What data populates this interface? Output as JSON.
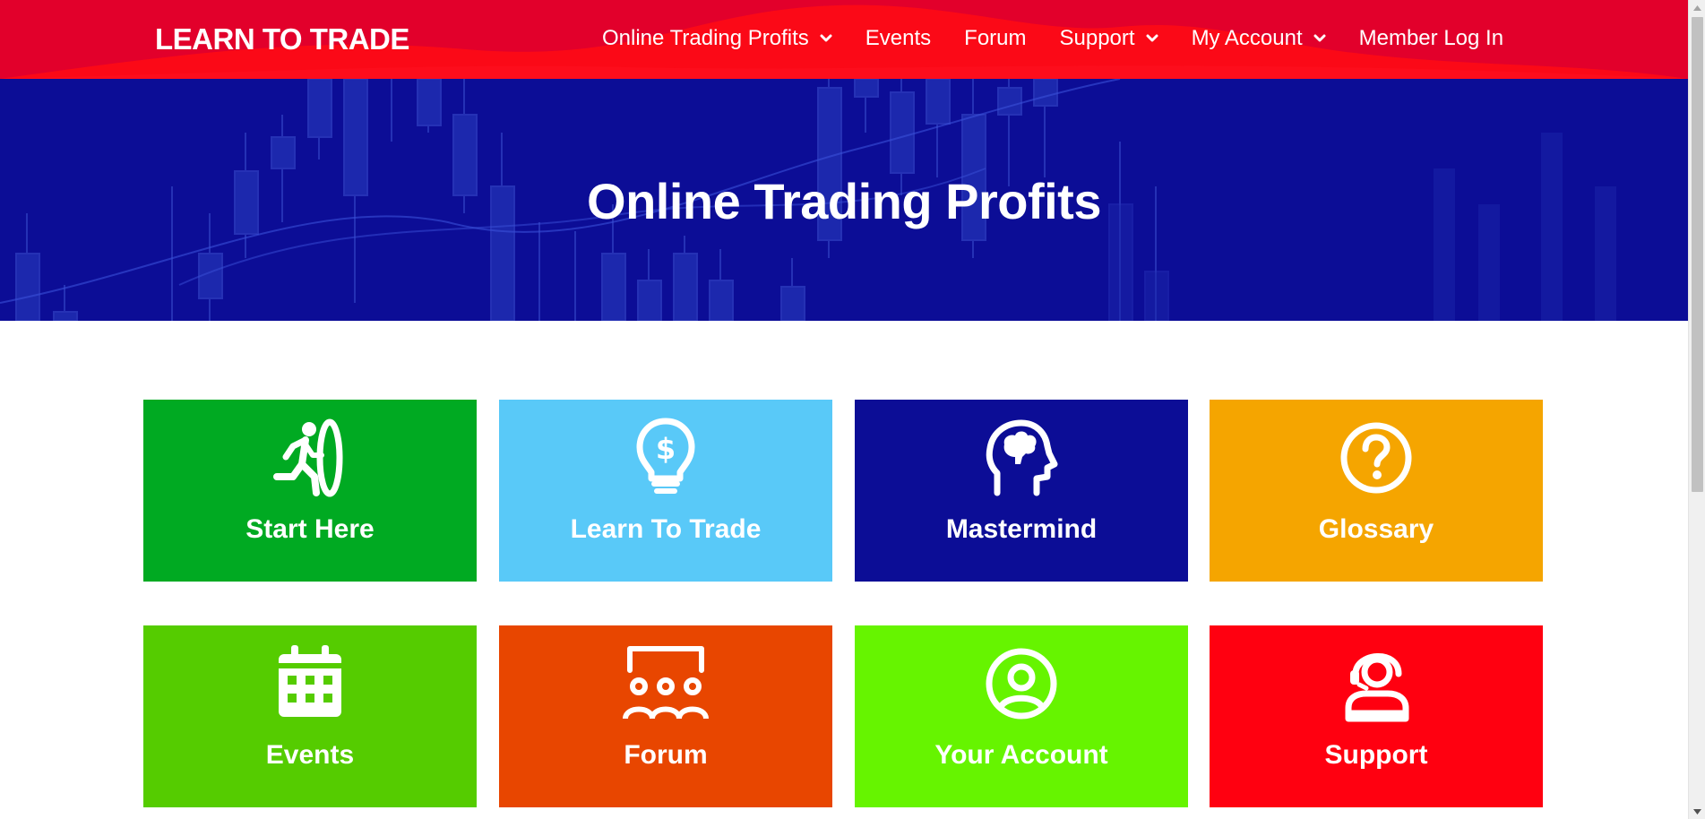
{
  "header": {
    "logo": "LEARN TO TRADE",
    "nav": [
      {
        "label": "Online Trading Profits",
        "dropdown": true
      },
      {
        "label": "Events",
        "dropdown": false
      },
      {
        "label": "Forum",
        "dropdown": false
      },
      {
        "label": "Support",
        "dropdown": true
      },
      {
        "label": "My Account",
        "dropdown": true
      },
      {
        "label": "Member Log In",
        "dropdown": false
      }
    ],
    "color": "#e2002b"
  },
  "hero": {
    "title": "Online Trading Profits",
    "color": "#0c0d96"
  },
  "tiles": [
    {
      "label": "Start Here",
      "icon": "running-person-door-icon",
      "color": "#00aa22"
    },
    {
      "label": "Learn To Trade",
      "icon": "lightbulb-dollar-icon",
      "color": "#59c9f8"
    },
    {
      "label": "Mastermind",
      "icon": "head-brain-icon",
      "color": "#0c0d96"
    },
    {
      "label": "Glossary",
      "icon": "question-circle-icon",
      "color": "#f5a500"
    },
    {
      "label": "Events",
      "icon": "calendar-icon",
      "color": "#55cc00"
    },
    {
      "label": "Forum",
      "icon": "group-meeting-icon",
      "color": "#e84600"
    },
    {
      "label": "Your Account",
      "icon": "user-circle-icon",
      "color": "#66f400"
    },
    {
      "label": "Support",
      "icon": "headset-support-icon",
      "color": "#ff0010"
    }
  ]
}
